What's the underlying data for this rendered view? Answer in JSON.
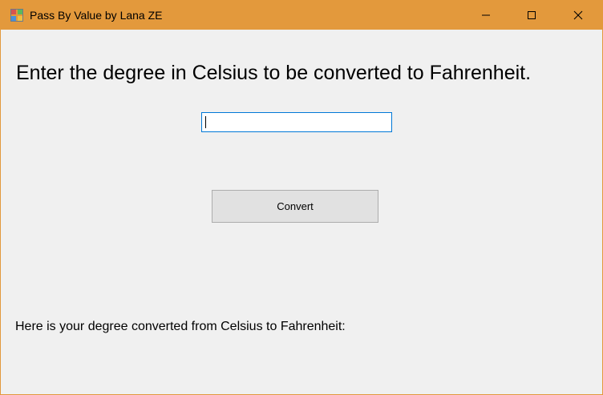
{
  "window": {
    "title": "Pass By Value by Lana ZE",
    "app_icon": "windows-form-icon",
    "controls": {
      "minimize_icon": "minimize-icon",
      "maximize_icon": "maximize-icon",
      "close_icon": "close-icon"
    },
    "titlebar_color": "#e3993c"
  },
  "form": {
    "prompt_text": "Enter the degree in Celsius to be converted to Fahrenheit.",
    "celsius_input": {
      "value": "",
      "focus_color": "#0078d7"
    },
    "convert_button_label": "Convert",
    "result_text": "Here is your degree converted from Celsius to Fahrenheit:"
  }
}
